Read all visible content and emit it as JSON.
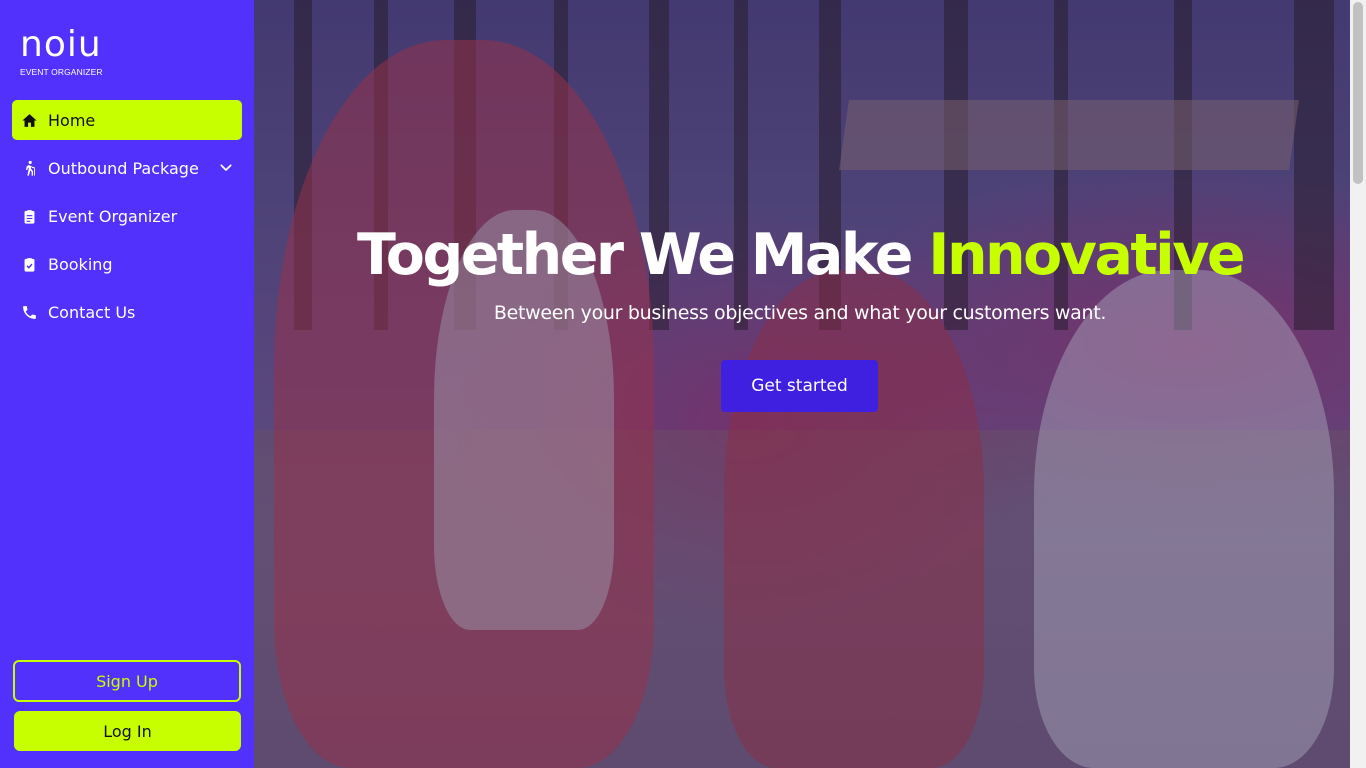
{
  "brand": {
    "name": "noiu",
    "tagline": "EVENT ORGANIZER"
  },
  "sidebar": {
    "items": [
      {
        "label": "Home",
        "icon": "home-icon",
        "active": true
      },
      {
        "label": "Outbound Package",
        "icon": "hiking-icon",
        "has_dropdown": true
      },
      {
        "label": "Event Organizer",
        "icon": "clipboard-icon"
      },
      {
        "label": "Booking",
        "icon": "clipboard-check-icon"
      },
      {
        "label": "Contact Us",
        "icon": "phone-icon"
      }
    ],
    "signup_label": "Sign Up",
    "login_label": "Log In"
  },
  "hero": {
    "title_main": "Together We Make ",
    "title_accent": "Innovative",
    "subtitle": "Between your business objectives and what your customers want.",
    "cta_label": "Get started"
  },
  "colors": {
    "sidebar_bg": "#5131fb",
    "accent": "#c8ff00",
    "cta_bg": "#3f1fe0"
  }
}
